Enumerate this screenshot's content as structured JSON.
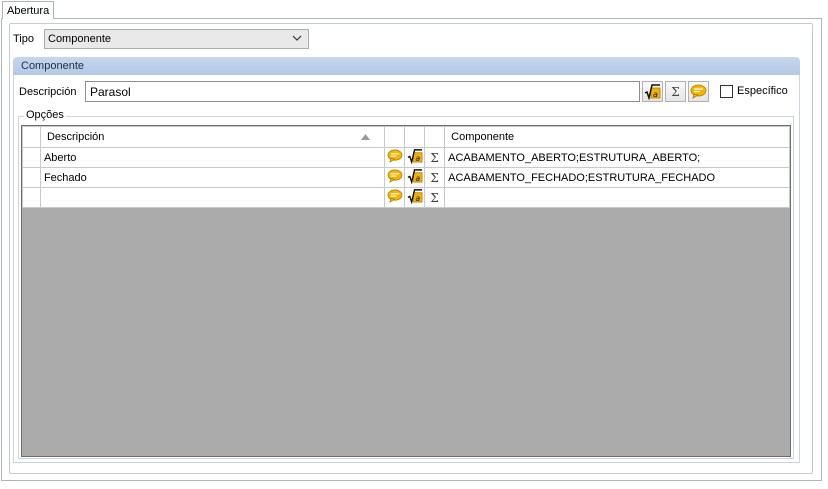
{
  "tab": {
    "label": "Abertura"
  },
  "tipo": {
    "label": "Tipo",
    "value": "Componente"
  },
  "group": {
    "title": "Componente"
  },
  "descripcion": {
    "label": "Descripción",
    "value": "Parasol"
  },
  "especifico": {
    "label": "Específico",
    "checked": false
  },
  "opcoes": {
    "legend": "Opções",
    "columns": {
      "descripcion": "Descripción",
      "componente": "Componente"
    },
    "rows": [
      {
        "descripcion": "Aberto",
        "componente": "ACABAMENTO_ABERTO;ESTRUTURA_ABERTO;"
      },
      {
        "descripcion": "Fechado",
        "componente": "ACABAMENTO_FECHADO;ESTRUTURA_FECHADO"
      },
      {
        "descripcion": "",
        "componente": ""
      }
    ]
  },
  "glyphs": {
    "sigma": "Σ"
  },
  "icons": [
    "formula-icon",
    "sigma-icon",
    "comment-icon",
    "chevron-down-icon",
    "sort-asc-icon"
  ],
  "colors": {
    "header_band": "#b9cce8",
    "grid_empty": "#ababab",
    "icon_gold": "#f2b200"
  }
}
